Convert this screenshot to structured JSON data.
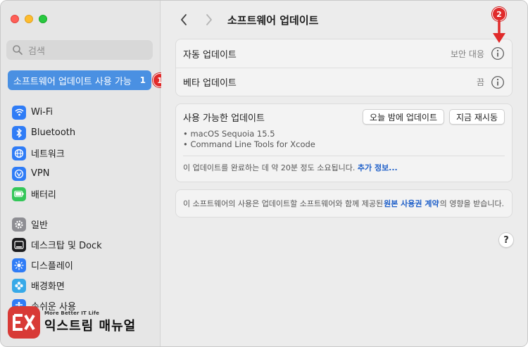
{
  "sidebar": {
    "search_placeholder": "검색",
    "update_item": {
      "label": "소프트웨어 업데이트 사용 가능",
      "count": "1"
    },
    "items": [
      {
        "label": "Wi-Fi",
        "icon": "wifi-icon",
        "color": "#2f7cf6"
      },
      {
        "label": "Bluetooth",
        "icon": "bluetooth-icon",
        "color": "#2f7cf6"
      },
      {
        "label": "네트워크",
        "icon": "network-icon",
        "color": "#2f7cf6"
      },
      {
        "label": "VPN",
        "icon": "vpn-icon",
        "color": "#2f7cf6"
      },
      {
        "label": "배터리",
        "icon": "battery-icon",
        "color": "#34c759"
      },
      {
        "label": "일반",
        "icon": "gear-icon",
        "color": "#8e8e93"
      },
      {
        "label": "데스크탑 및 Dock",
        "icon": "dock-icon",
        "color": "#1c1c1e"
      },
      {
        "label": "디스플레이",
        "icon": "display-icon",
        "color": "#2f7cf6"
      },
      {
        "label": "배경화면",
        "icon": "wallpaper-icon",
        "color": "#37a9e8"
      },
      {
        "label": "손쉬운 사용",
        "icon": "accessibility-icon",
        "color": "#2f7cf6"
      }
    ]
  },
  "annotations": {
    "one": "1",
    "two": "2"
  },
  "header": {
    "title": "소프트웨어 업데이트"
  },
  "settings": [
    {
      "label": "자동 업데이트",
      "value": "보안 대응"
    },
    {
      "label": "베타 업데이트",
      "value": "끔"
    }
  ],
  "available": {
    "title": "사용 가능한 업데이트",
    "update_tonight": "오늘 밤에 업데이트",
    "restart_now": "지금 재시동",
    "items": [
      "• macOS Sequoia 15.5",
      "• Command Line Tools for Xcode"
    ],
    "time_text": "이 업데이트를 완료하는 데 약 20분 정도 소요됩니다. ",
    "more_info": "추가 정보..."
  },
  "license": {
    "prefix": "이 소프트웨어의 사용은 업데이트할 소프트웨어와 함께 제공된 ",
    "link": "원본 사용권 계약",
    "suffix": "의 영향을 받습니다."
  },
  "help": "?",
  "logo": {
    "tagline": "More Better IT Life",
    "name": "익스트림 매뉴얼",
    "badge": "EX"
  },
  "colors": {
    "accent": "#4a90e2",
    "link": "#1e5fc9",
    "annotation": "#e02a2a"
  }
}
